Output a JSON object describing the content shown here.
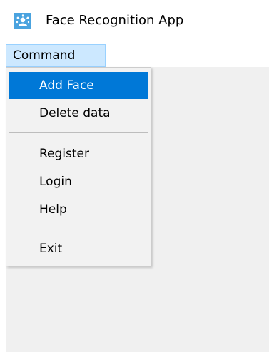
{
  "window": {
    "title": "Face Recognition App",
    "icon": "face-recognition-app-icon"
  },
  "menubar": {
    "items": [
      {
        "label": "Command",
        "state": "open"
      }
    ]
  },
  "dropdown": {
    "items": [
      {
        "label": "Add Face",
        "highlighted": true
      },
      {
        "label": "Delete data"
      },
      {
        "label": "Register"
      },
      {
        "label": "Login"
      },
      {
        "label": "Help"
      },
      {
        "label": "Exit"
      }
    ]
  },
  "colors": {
    "highlight": "#0078d7",
    "menu_open_bg": "#cce8ff",
    "client_bg": "#f0f0f0"
  }
}
